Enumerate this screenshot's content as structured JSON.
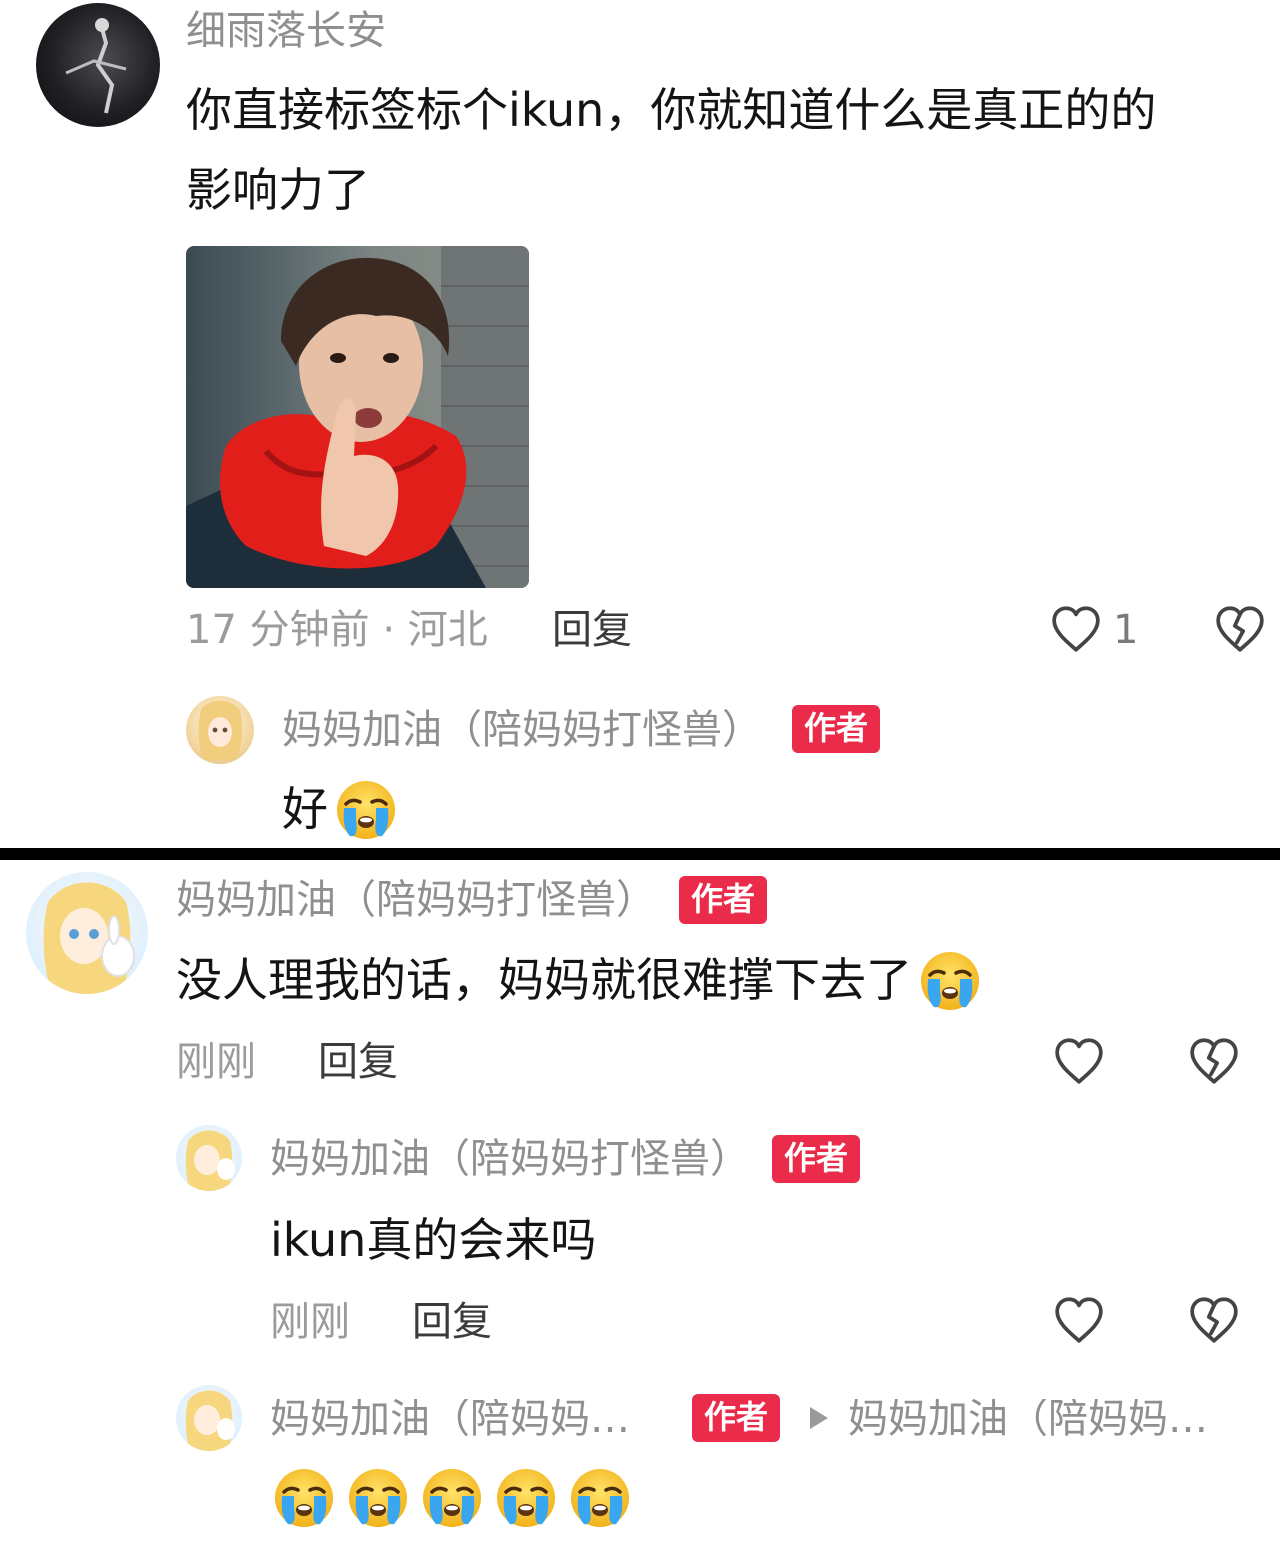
{
  "comment1": {
    "username": "细雨落长安",
    "text_line1": "你直接标签标个ikun，你就知道什么是真正的的",
    "text_line2": "影响力了",
    "meta": "17 分钟前 · 河北",
    "reply_label": "回复",
    "like_count": "1"
  },
  "reply1": {
    "username": "妈妈加油（陪妈妈打怪兽）",
    "badge": "作者",
    "text": "好"
  },
  "comment2": {
    "username": "妈妈加油（陪妈妈打怪兽）",
    "badge": "作者",
    "text": "没人理我的话，妈妈就很难撑下去了",
    "meta": "刚刚",
    "reply_label": "回复"
  },
  "reply2": {
    "username": "妈妈加油（陪妈妈打怪兽）",
    "badge": "作者",
    "text": "ikun真的会来吗",
    "meta": "刚刚",
    "reply_label": "回复"
  },
  "reply3": {
    "username": "妈妈加油（陪妈妈…",
    "badge": "作者",
    "reply_to": "妈妈加油（陪妈妈…"
  },
  "colors": {
    "badge": "#ea2c4a",
    "divider": "#000000",
    "meta_text": "#9b9b9b"
  },
  "icons": [
    "heart-outline-icon",
    "broken-heart-icon",
    "crying-face-emoji",
    "play-triangle-icon"
  ]
}
